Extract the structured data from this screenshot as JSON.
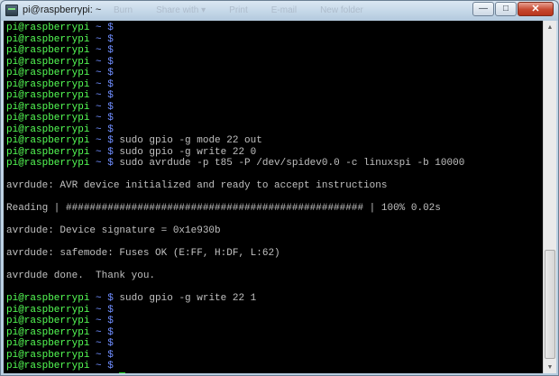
{
  "window": {
    "title": "pi@raspberrypi: ~",
    "background_menu": [
      "Burn",
      "Share with ▾",
      "Print",
      "E-mail",
      "New folder"
    ],
    "minimize_label": "—",
    "maximize_label": "□",
    "close_label": "✕"
  },
  "terminal": {
    "prompt_user": "pi@raspberrypi",
    "prompt_tail": " ~ $",
    "colors": {
      "prompt_user": "#55ff55",
      "prompt_tail": "#6f8dff",
      "output": "#c0c0c0",
      "cursor": "#27d827",
      "background": "#000000"
    },
    "lines": [
      {
        "type": "prompt",
        "cmd": ""
      },
      {
        "type": "prompt",
        "cmd": ""
      },
      {
        "type": "prompt",
        "cmd": ""
      },
      {
        "type": "prompt",
        "cmd": ""
      },
      {
        "type": "prompt",
        "cmd": ""
      },
      {
        "type": "prompt",
        "cmd": ""
      },
      {
        "type": "prompt",
        "cmd": ""
      },
      {
        "type": "prompt",
        "cmd": ""
      },
      {
        "type": "prompt",
        "cmd": ""
      },
      {
        "type": "prompt",
        "cmd": ""
      },
      {
        "type": "prompt",
        "cmd": " sudo gpio -g mode 22 out"
      },
      {
        "type": "prompt",
        "cmd": " sudo gpio -g write 22 0"
      },
      {
        "type": "prompt",
        "cmd": " sudo avrdude -p t85 -P /dev/spidev0.0 -c linuxspi -b 10000"
      },
      {
        "type": "output",
        "text": ""
      },
      {
        "type": "output",
        "text": "avrdude: AVR device initialized and ready to accept instructions"
      },
      {
        "type": "output",
        "text": ""
      },
      {
        "type": "output",
        "text": "Reading | ################################################## | 100% 0.02s"
      },
      {
        "type": "output",
        "text": ""
      },
      {
        "type": "output",
        "text": "avrdude: Device signature = 0x1e930b"
      },
      {
        "type": "output",
        "text": ""
      },
      {
        "type": "output",
        "text": "avrdude: safemode: Fuses OK (E:FF, H:DF, L:62)"
      },
      {
        "type": "output",
        "text": ""
      },
      {
        "type": "output",
        "text": "avrdude done.  Thank you."
      },
      {
        "type": "output",
        "text": ""
      },
      {
        "type": "prompt",
        "cmd": " sudo gpio -g write 22 1"
      },
      {
        "type": "prompt",
        "cmd": ""
      },
      {
        "type": "prompt",
        "cmd": ""
      },
      {
        "type": "prompt",
        "cmd": ""
      },
      {
        "type": "prompt",
        "cmd": ""
      },
      {
        "type": "prompt",
        "cmd": ""
      },
      {
        "type": "prompt",
        "cmd": ""
      },
      {
        "type": "prompt",
        "cmd": "",
        "cursor": true
      }
    ]
  },
  "scrollbar": {
    "up_arrow": "▲",
    "down_arrow": "▼"
  }
}
